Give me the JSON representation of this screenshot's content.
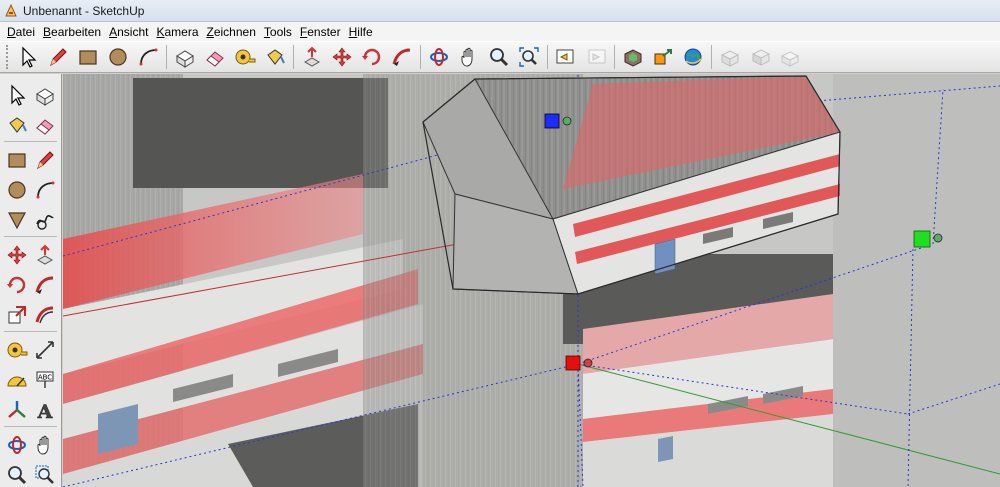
{
  "window": {
    "title": "Unbenannt - SketchUp"
  },
  "menu": [
    {
      "label": "Datei",
      "acc": "D",
      "rest": "atei"
    },
    {
      "label": "Bearbeiten",
      "acc": "B",
      "rest": "earbeiten"
    },
    {
      "label": "Ansicht",
      "acc": "A",
      "rest": "nsicht"
    },
    {
      "label": "Kamera",
      "acc": "K",
      "rest": "amera"
    },
    {
      "label": "Zeichnen",
      "acc": "Z",
      "rest": "eichnen"
    },
    {
      "label": "Tools",
      "acc": "T",
      "rest": "ools"
    },
    {
      "label": "Fenster",
      "acc": "F",
      "rest": "enster"
    },
    {
      "label": "Hilfe",
      "acc": "H",
      "rest": "ilfe"
    }
  ],
  "toolbar_icons": [
    "select-icon",
    "pencil-icon",
    "rectangle-icon",
    "circle-icon",
    "arc-icon",
    "make-component-icon",
    "eraser-icon",
    "tape-measure-icon",
    "paint-bucket-icon",
    "push-pull-icon",
    "move-icon",
    "rotate-icon",
    "follow-me-icon",
    "orbit-icon",
    "pan-icon",
    "zoom-icon",
    "zoom-extents-icon",
    "previous-view-icon",
    "next-view-icon",
    "get-models-icon",
    "share-model-icon",
    "google-earth-icon",
    "component-a-icon",
    "component-b-icon",
    "component-c-icon"
  ],
  "palette_icons": [
    [
      "select-icon",
      "make-component-icon"
    ],
    [
      "paint-bucket-icon",
      "eraser-icon"
    ],
    [
      "rectangle-icon",
      "pencil-icon"
    ],
    [
      "circle-icon",
      "arc-icon"
    ],
    [
      "polygon-icon",
      "freehand-icon"
    ],
    [
      "move-icon",
      "push-pull-icon"
    ],
    [
      "rotate-icon",
      "follow-me-icon"
    ],
    [
      "scale-icon",
      "offset-icon"
    ],
    [
      "tape-measure-icon",
      "dimension-icon"
    ],
    [
      "protractor-icon",
      "text-icon"
    ],
    [
      "axes-icon",
      "3d-text-icon"
    ],
    [
      "orbit-icon",
      "pan-icon"
    ],
    [
      "zoom-icon",
      "zoom-window-icon"
    ]
  ],
  "palette_labels": {
    "text_tool": "ABC",
    "text3d_tool": "A"
  },
  "colors": {
    "red_axis": "#c03030",
    "green_axis": "#2f9e2f",
    "blue_axis": "#2020c8",
    "roof_red": "#e23b3b",
    "facade": "#e6e6e4"
  }
}
